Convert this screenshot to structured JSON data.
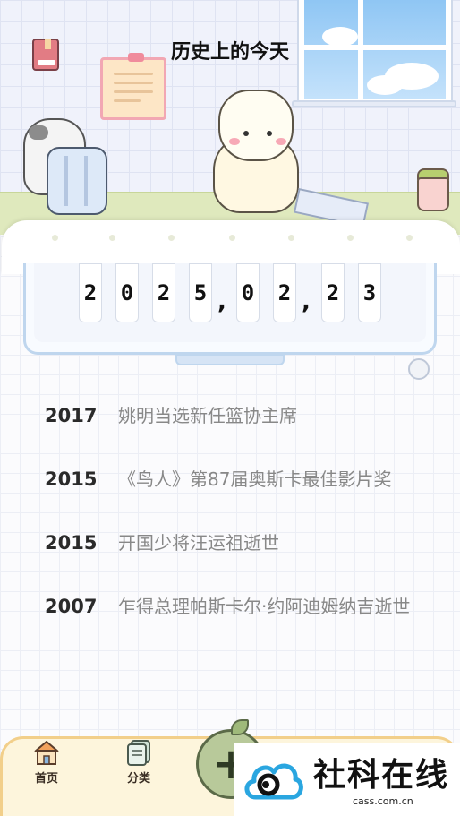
{
  "header": {
    "title": "历史上的今天"
  },
  "date": {
    "digits": [
      "2",
      "0",
      "2",
      "5",
      "0",
      "2",
      "2",
      "3"
    ],
    "separators": [
      ",",
      ","
    ]
  },
  "events": [
    {
      "year": "2017",
      "text": "姚明当选新任篮协主席"
    },
    {
      "year": "2015",
      "text": "《鸟人》第87届奥斯卡最佳影片奖"
    },
    {
      "year": "2015",
      "text": "开国少将汪运祖逝世"
    },
    {
      "year": "2007",
      "text": "乍得总理帕斯卡尔·约阿迪姆纳吉逝世"
    }
  ],
  "nav": {
    "home_label": "首页",
    "category_label": "分类",
    "add_icon": "plus-icon"
  },
  "watermark": {
    "title": "社科在线",
    "subtitle": "cass.com.cn"
  },
  "colors": {
    "nav_bg": "#fdf5dc",
    "nav_border": "#f2cf8a",
    "add_button": "#b8c99a",
    "monitor_border": "#bfd6ee",
    "year_text": "#2a2a2a",
    "event_text": "#888888"
  }
}
